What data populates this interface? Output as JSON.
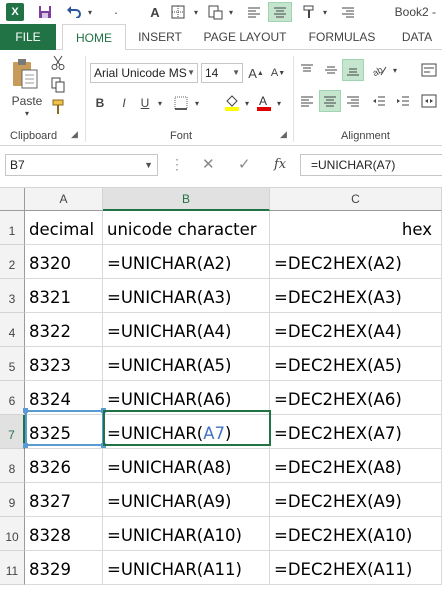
{
  "app": {
    "title": "Book2 -",
    "logo_letter": "X",
    "accent": "#217346"
  },
  "qat_icons": [
    "excel-logo",
    "save-icon",
    "undo-icon",
    "undo-dropdown-icon",
    "font-color-icon",
    "borders-icon",
    "paste-options-icon",
    "align-left-icon",
    "align-center-icon",
    "format-painter-icon",
    "align-right-icon"
  ],
  "ribbon_tabs": [
    "FILE",
    "HOME",
    "INSERT",
    "PAGE LAYOUT",
    "FORMULAS",
    "DATA"
  ],
  "active_tab": "HOME",
  "clipboard": {
    "paste_label": "Paste",
    "group_label": "Clipboard"
  },
  "font": {
    "name": "Arial Unicode MS",
    "size": "14",
    "group_label": "Font",
    "bold": "B",
    "italic": "I",
    "underline": "U"
  },
  "alignment": {
    "group_label": "Alignment"
  },
  "formula_bar": {
    "name_box": "B7",
    "cancel": "✕",
    "enter": "✓",
    "fx": "fx",
    "formula": "=UNICHAR(A7)"
  },
  "columns": [
    "A",
    "B",
    "C"
  ],
  "rows": [
    {
      "num": "1",
      "a": "decimal",
      "b": "unicode character",
      "c": "hex"
    },
    {
      "num": "2",
      "a": "8320",
      "b": "=UNICHAR(A2)",
      "c": "=DEC2HEX(A2)"
    },
    {
      "num": "3",
      "a": "8321",
      "b": "=UNICHAR(A3)",
      "c": "=DEC2HEX(A3)"
    },
    {
      "num": "4",
      "a": "8322",
      "b": "=UNICHAR(A4)",
      "c": "=DEC2HEX(A4)"
    },
    {
      "num": "5",
      "a": "8323",
      "b": "=UNICHAR(A5)",
      "c": "=DEC2HEX(A5)"
    },
    {
      "num": "6",
      "a": "8324",
      "b": "=UNICHAR(A6)",
      "c": "=DEC2HEX(A6)"
    },
    {
      "num": "7",
      "a": "8325",
      "b": "=UNICHAR(A7)",
      "c": "=DEC2HEX(A7)"
    },
    {
      "num": "8",
      "a": "8326",
      "b": "=UNICHAR(A8)",
      "c": "=DEC2HEX(A8)"
    },
    {
      "num": "9",
      "a": "8327",
      "b": "=UNICHAR(A9)",
      "c": "=DEC2HEX(A9)"
    },
    {
      "num": "10",
      "a": "8328",
      "b": "=UNICHAR(A10)",
      "c": "=DEC2HEX(A10)"
    },
    {
      "num": "11",
      "a": "8329",
      "b": "=UNICHAR(A11)",
      "c": "=DEC2HEX(A11)"
    }
  ],
  "active_cell": "B7",
  "editing": {
    "prefix": "=UNICHAR(",
    "ref": "A7",
    "suffix": ")"
  }
}
